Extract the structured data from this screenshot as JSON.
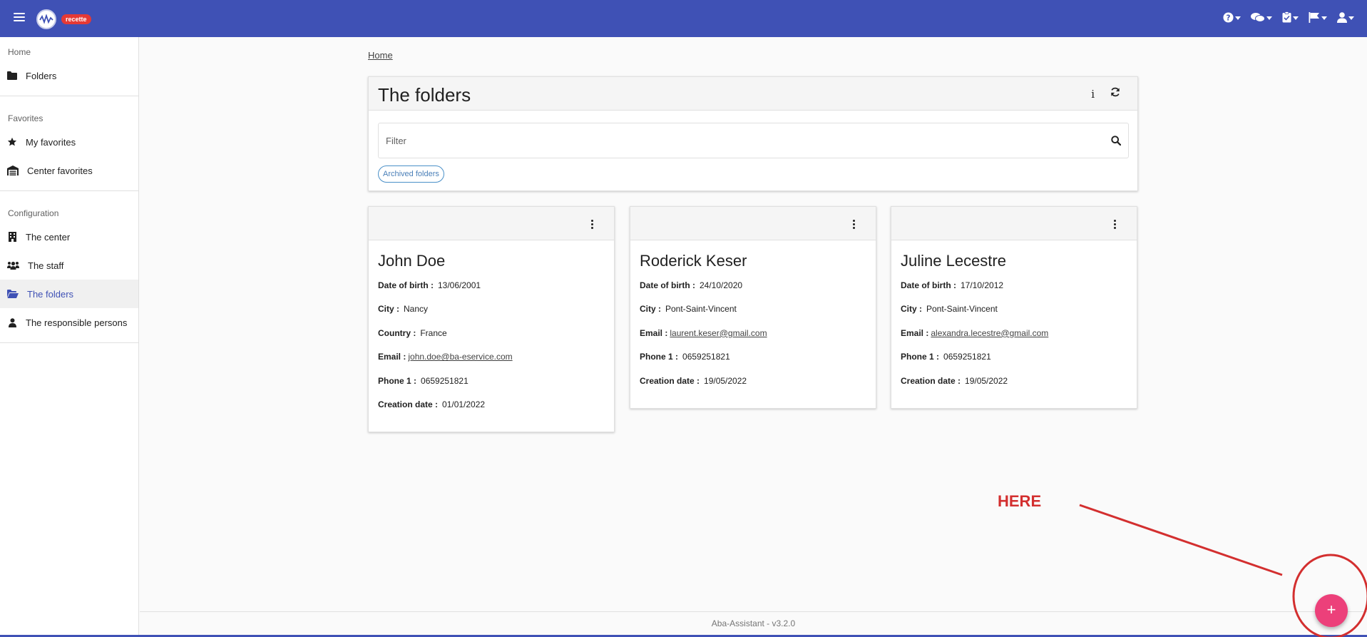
{
  "topbar": {
    "env_badge": "recette",
    "actions": [
      "help-icon",
      "chat-icon",
      "clipboard-check-icon",
      "flag-icon",
      "user-icon"
    ]
  },
  "sidebar": {
    "sections": [
      {
        "heading": "Home",
        "items": [
          {
            "label": "Folders",
            "icon": "folder-icon"
          }
        ]
      },
      {
        "heading": "Favorites",
        "items": [
          {
            "label": "My favorites",
            "icon": "star-icon"
          },
          {
            "label": "Center favorites",
            "icon": "warehouse-icon"
          }
        ]
      },
      {
        "heading": "Configuration",
        "items": [
          {
            "label": "The center",
            "icon": "building-icon"
          },
          {
            "label": "The staff",
            "icon": "users-icon"
          },
          {
            "label": "The folders",
            "icon": "folder-open-icon",
            "active": true
          },
          {
            "label": "The responsible persons",
            "icon": "user-icon"
          }
        ]
      }
    ]
  },
  "breadcrumb": "Home",
  "panel": {
    "title": "The folders",
    "info_label": "i",
    "filter_placeholder": "Filter",
    "chip_label": "Archived folders"
  },
  "cards": [
    {
      "name": "John Doe",
      "fields": [
        {
          "label": "Date of birth :",
          "value": "13/06/2001"
        },
        {
          "label": "City :",
          "value": "Nancy"
        },
        {
          "label": "Country :",
          "value": "France"
        },
        {
          "label": "Email :",
          "value": "john.doe@ba-eservice.com",
          "link": true
        },
        {
          "label": "Phone 1 :",
          "value": "0659251821"
        },
        {
          "label": "Creation date :",
          "value": "01/01/2022"
        }
      ]
    },
    {
      "name": "Roderick Keser",
      "fields": [
        {
          "label": "Date of birth :",
          "value": "24/10/2020"
        },
        {
          "label": "City :",
          "value": "Pont-Saint-Vincent"
        },
        {
          "label": "Email :",
          "value": "laurent.keser@gmail.com",
          "link": true
        },
        {
          "label": "Phone 1 :",
          "value": "0659251821"
        },
        {
          "label": "Creation date :",
          "value": "19/05/2022"
        }
      ]
    },
    {
      "name": "Juline Lecestre",
      "fields": [
        {
          "label": "Date of birth :",
          "value": "17/10/2012"
        },
        {
          "label": "City :",
          "value": "Pont-Saint-Vincent"
        },
        {
          "label": "Email :",
          "value": "alexandra.lecestre@gmail.com",
          "link": true
        },
        {
          "label": "Phone 1 :",
          "value": "0659251821"
        },
        {
          "label": "Creation date :",
          "value": "19/05/2022"
        }
      ]
    }
  ],
  "footer": "Aba-Assistant - v3.2.0",
  "annotation": {
    "label": "HERE",
    "color": "#d32f2f"
  },
  "fab": {
    "label": "+",
    "color": "#ec407a"
  },
  "colors": {
    "primary": "#3f51b5",
    "badge": "#e53935",
    "chip": "#4a90c8"
  }
}
